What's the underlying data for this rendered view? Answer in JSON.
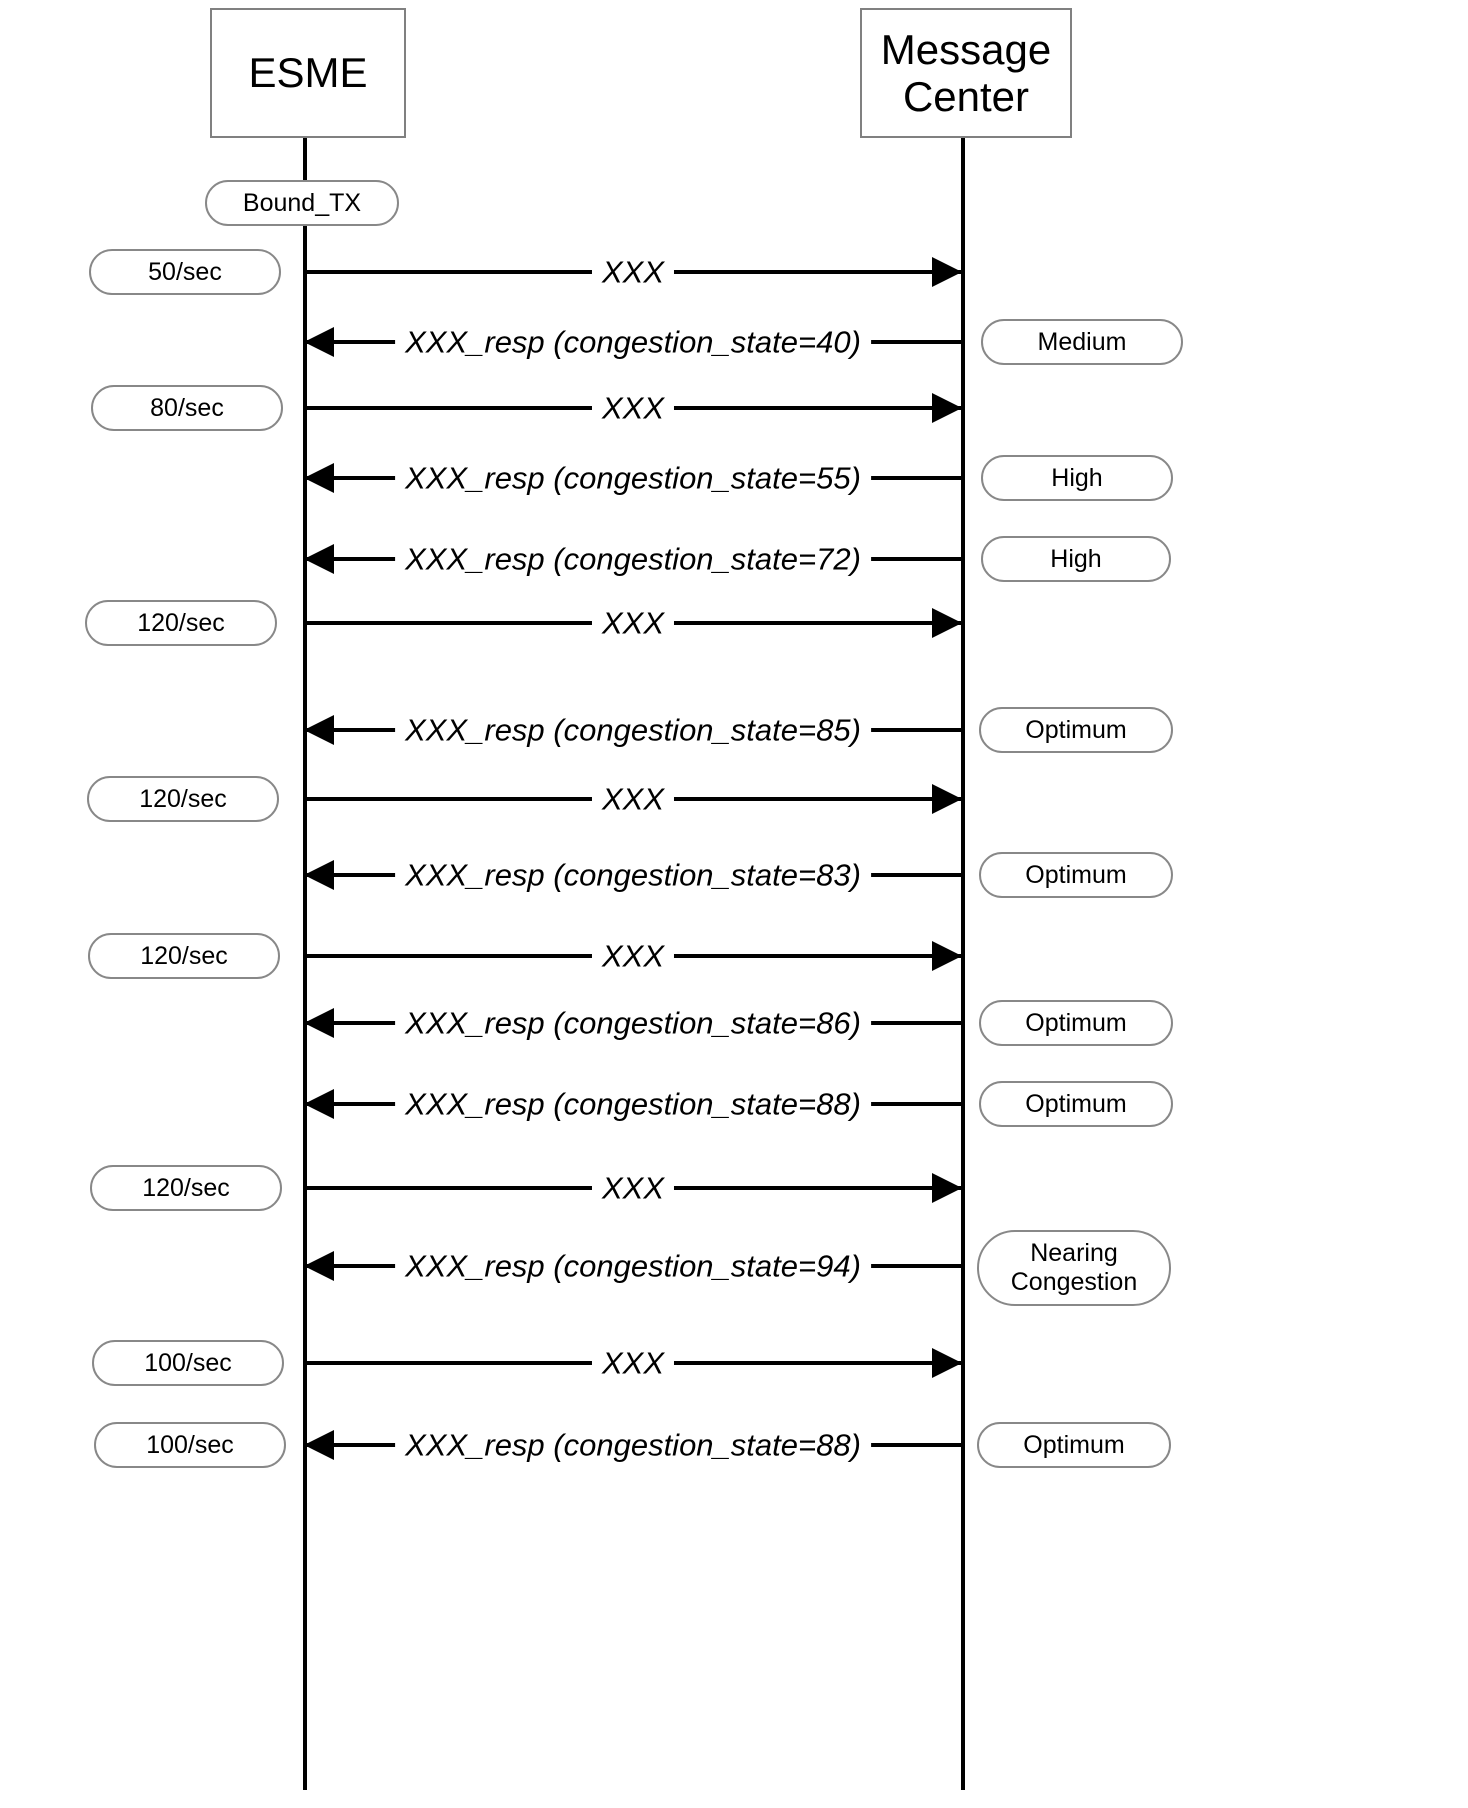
{
  "diagram": {
    "type": "sequence-diagram",
    "actors": [
      {
        "id": "esme",
        "name": "ESME"
      },
      {
        "id": "message_center",
        "name": "Message Center"
      }
    ],
    "state_label": "Bound_TX",
    "messages": [
      {
        "left_label": "50/sec",
        "text": "XXX",
        "direction": "right",
        "right_label": ""
      },
      {
        "left_label": "",
        "text": "XXX_resp (congestion_state=40)",
        "direction": "left",
        "right_label": "Medium"
      },
      {
        "left_label": "80/sec",
        "text": "XXX",
        "direction": "right",
        "right_label": ""
      },
      {
        "left_label": "",
        "text": "XXX_resp (congestion_state=55)",
        "direction": "left",
        "right_label": "High"
      },
      {
        "left_label": "",
        "text": "XXX_resp (congestion_state=72)",
        "direction": "left",
        "right_label": "High"
      },
      {
        "left_label": "120/sec",
        "text": "XXX",
        "direction": "right",
        "right_label": ""
      },
      {
        "left_label": "",
        "text": "XXX_resp (congestion_state=85)",
        "direction": "left",
        "right_label": "Optimum"
      },
      {
        "left_label": "120/sec",
        "text": "XXX",
        "direction": "right",
        "right_label": ""
      },
      {
        "left_label": "",
        "text": "XXX_resp (congestion_state=83)",
        "direction": "left",
        "right_label": "Optimum"
      },
      {
        "left_label": "120/sec",
        "text": "XXX",
        "direction": "right",
        "right_label": ""
      },
      {
        "left_label": "",
        "text": "XXX_resp (congestion_state=86)",
        "direction": "left",
        "right_label": "Optimum"
      },
      {
        "left_label": "",
        "text": "XXX_resp (congestion_state=88)",
        "direction": "left",
        "right_label": "Optimum"
      },
      {
        "left_label": "120/sec",
        "text": "XXX",
        "direction": "right",
        "right_label": ""
      },
      {
        "left_label": "",
        "text": "XXX_resp (congestion_state=94)",
        "direction": "left",
        "right_label": "Nearing\nCongestion"
      },
      {
        "left_label": "100/sec",
        "text": "XXX",
        "direction": "right",
        "right_label": ""
      },
      {
        "left_label": "100/sec",
        "text": "XXX_resp (congestion_state=88)",
        "direction": "left",
        "right_label": "Optimum"
      }
    ],
    "colors": {
      "line": "#000000",
      "box_border": "#808080",
      "pill_border": "#888888",
      "background": "#ffffff"
    }
  }
}
